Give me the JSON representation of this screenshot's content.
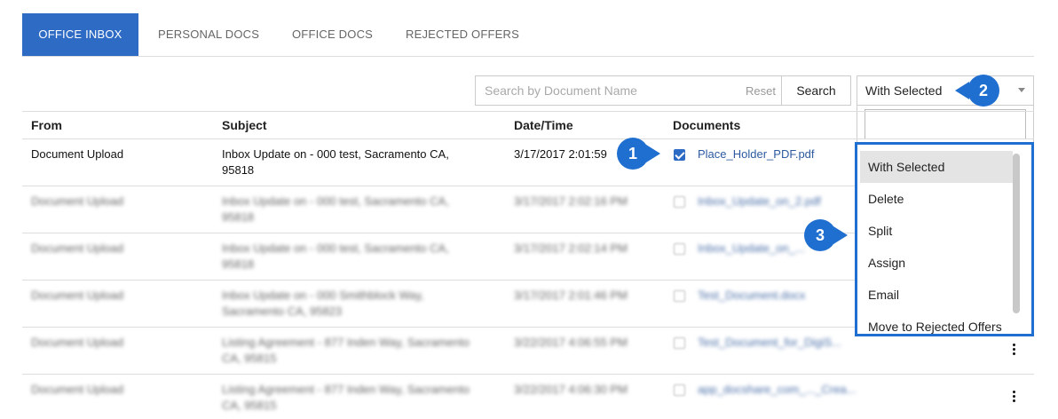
{
  "tabs": [
    {
      "label": "OFFICE INBOX",
      "active": true
    },
    {
      "label": "PERSONAL DOCS",
      "active": false
    },
    {
      "label": "OFFICE DOCS",
      "active": false
    },
    {
      "label": "REJECTED OFFERS",
      "active": false
    }
  ],
  "search": {
    "placeholder": "Search by Document Name",
    "reset_label": "Reset",
    "button_label": "Search"
  },
  "bulk_select": {
    "selected": "With Selected",
    "options": [
      "With Selected",
      "Delete",
      "Split",
      "Assign",
      "Email",
      "Move to Rejected Offers"
    ],
    "highlighted": "With Selected"
  },
  "table": {
    "headers": {
      "from": "From",
      "subject": "Subject",
      "datetime": "Date/Time",
      "documents": "Documents"
    },
    "rows": [
      {
        "from": "Document Upload",
        "subject_l1": "Inbox Update on - 000 test, Sacramento CA,",
        "subject_l2": "95818",
        "datetime": "3/17/2017 2:01:59",
        "document": "Place_Holder_PDF.pdf",
        "checked": true
      },
      {
        "from": "Document Upload",
        "subject_l1": "Inbox Update on - 000 test, Sacramento CA,",
        "subject_l2": "95818",
        "datetime": "3/17/2017 2:02:16 PM",
        "document": "Inbox_Update_on_2.pdf",
        "checked": false
      },
      {
        "from": "Document Upload",
        "subject_l1": "Inbox Update on - 000 test, Sacramento CA,",
        "subject_l2": "95818",
        "datetime": "3/17/2017 2:02:14 PM",
        "document": "Inbox_Update_on_...",
        "checked": false
      },
      {
        "from": "Document Upload",
        "subject_l1": "Inbox Update on - 000 Smithblock Way,",
        "subject_l2": "Sacramento CA, 95823",
        "datetime": "3/17/2017 2:01:46 PM",
        "document": "Test_Document.docx",
        "checked": false
      },
      {
        "from": "Document Upload",
        "subject_l1": "Listing Agreement - 877 Inden Way, Sacramento",
        "subject_l2": "CA, 95815",
        "datetime": "3/22/2017 4:06:55 PM",
        "document": "Test_Document_for_DigiS...",
        "checked": false
      },
      {
        "from": "Document Upload",
        "subject_l1": "Listing Agreement - 877 Inden Way, Sacramento",
        "subject_l2": "CA, 95815",
        "datetime": "3/22/2017 4:06:30 PM",
        "document": "app_docshare_com_..._Crea...",
        "checked": false
      }
    ]
  },
  "callouts": {
    "one": "1",
    "two": "2",
    "three": "3"
  },
  "colors": {
    "accent": "#2d6bc5",
    "callout": "#1f6fd0"
  }
}
